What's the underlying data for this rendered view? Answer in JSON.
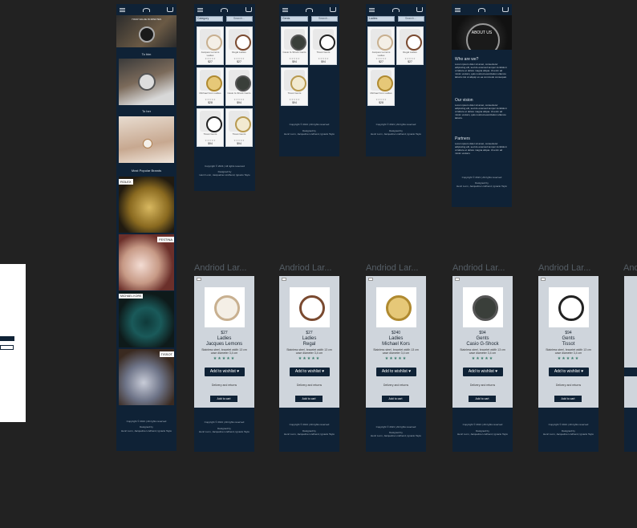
{
  "colors": {
    "canvas": "#222222",
    "frame": "#0f2236",
    "light": "#cfd5dc",
    "accent": "#3a7a6a"
  },
  "icons": [
    "menu-icon",
    "logo-icon",
    "cart-icon",
    "search-icon",
    "back-icon",
    "heart-icon"
  ],
  "home": {
    "hero_text": "YOUR VALUE IN MINUTES",
    "for_him": "To him",
    "for_her": "To her",
    "popular_brands": "Most Popular Brands",
    "brands": [
      "ROLEX",
      "FESTINA",
      "MICHAEL KORS",
      "TISSOT"
    ],
    "footer_copyright": "Copyright © 2021 | All rights reserved",
    "footer_designed": "Designed by",
    "footer_names": "Henri Lunn, Jacqueline Lindhend, Ignacio Taylo"
  },
  "filters": {
    "category_all": "Category",
    "category_gents": "Gents",
    "category_ladies": "Ladies",
    "search_placeholder": "Search..."
  },
  "list_all": [
    {
      "name": "Jacques Lemons Ladies",
      "price": "$27"
    },
    {
      "name": "Regal Ladies",
      "price": "$27"
    },
    {
      "name": "Michael Kors Ladies",
      "price": "$28"
    },
    {
      "name": "Casio G-Shock Gents",
      "price": "$94"
    },
    {
      "name": "Tissot Gents",
      "price": "$94"
    },
    {
      "name": "Tissot Gents",
      "price": "$94"
    }
  ],
  "list_gents": [
    {
      "name": "Casio G-Shock Gents",
      "price": "$94"
    },
    {
      "name": "Tissot Gents",
      "price": "$94"
    },
    {
      "name": "Tissot Gents",
      "price": "$94"
    }
  ],
  "list_ladies": [
    {
      "name": "Jacques Lemons Ladies",
      "price": "$27"
    },
    {
      "name": "Regal Ladies",
      "price": "$27"
    },
    {
      "name": "Michael Kors Ladies",
      "price": "$28"
    }
  ],
  "about": {
    "hero": "ABOUT US",
    "who_title": "Who are we?",
    "who_text": "Lorem ipsum dolor sit amet, consectetur adipiscing elit, sed do eiusmod tempor incididunt ut labore et dolore magna aliqua. Ut enim ad minim veniam, quis nostrud exercitation ullamco laboris nisi ut aliquip ex ea commodo consequat.",
    "vision_title": "Our vision",
    "vision_text": "Lorem ipsum dolor sit amet, consectetur adipiscing elit, sed do eiusmod tempor incididunt ut labore et dolore magna aliqua. Ut enim ad minim veniam, quis nostrud exercitation ullamco laboris.",
    "partners_title": "Partners",
    "partners_text": "Lorem ipsum dolor sit amet, consectetur adipiscing elit, sed do eiusmod tempor incididunt ut labore et dolore magna aliqua. Ut enim ad minim veniam."
  },
  "product_pages": [
    {
      "title": "Andriod Lar...",
      "price": "$27",
      "category": "Ladies",
      "name": "Jacques Lemons",
      "desc": "Stainless steel, bracelet width 13 cm case diameter 3,4 cm",
      "stars": "★★★★★",
      "wishlist": "Add to wishlist",
      "delivery": "Delivery and returns",
      "cart": "Add to cart"
    },
    {
      "title": "Andriod Lar...",
      "price": "$27",
      "category": "Ladies",
      "name": "Regal",
      "desc": "Stainless steel, bracelet width 13 cm case diameter 3,4 cm",
      "stars": "★★★★★",
      "wishlist": "Add to wishlist",
      "delivery": "Delivery and returns",
      "cart": "Add to cart"
    },
    {
      "title": "Andriod Lar...",
      "price": "$240",
      "category": "Ladies",
      "name": "Michael Kors",
      "desc": "Stainless steel, bracelet width 13 cm case diameter 3,4 cm",
      "stars": "★★★★★",
      "wishlist": "Add to wishlist",
      "delivery": "Delivery and returns",
      "cart": "Add to cart"
    },
    {
      "title": "Andriod Lar...",
      "price": "$94",
      "category": "Gents",
      "name": "Casio G-Shock",
      "desc": "Stainless steel, bracelet width 13 cm case diameter 3,4 cm",
      "stars": "★★★★★",
      "wishlist": "Add to wishlist",
      "delivery": "Delivery and returns",
      "cart": "Add to cart"
    },
    {
      "title": "Andriod Lar...",
      "price": "$94",
      "category": "Gents",
      "name": "Tissot",
      "desc": "Stainless steel, bracelet width 13 cm case diameter 3,4 cm",
      "stars": "★★★★★",
      "wishlist": "Add to wishlist",
      "delivery": "Delivery and returns",
      "cart": "Add to cart"
    },
    {
      "title": "Andr"
    }
  ]
}
